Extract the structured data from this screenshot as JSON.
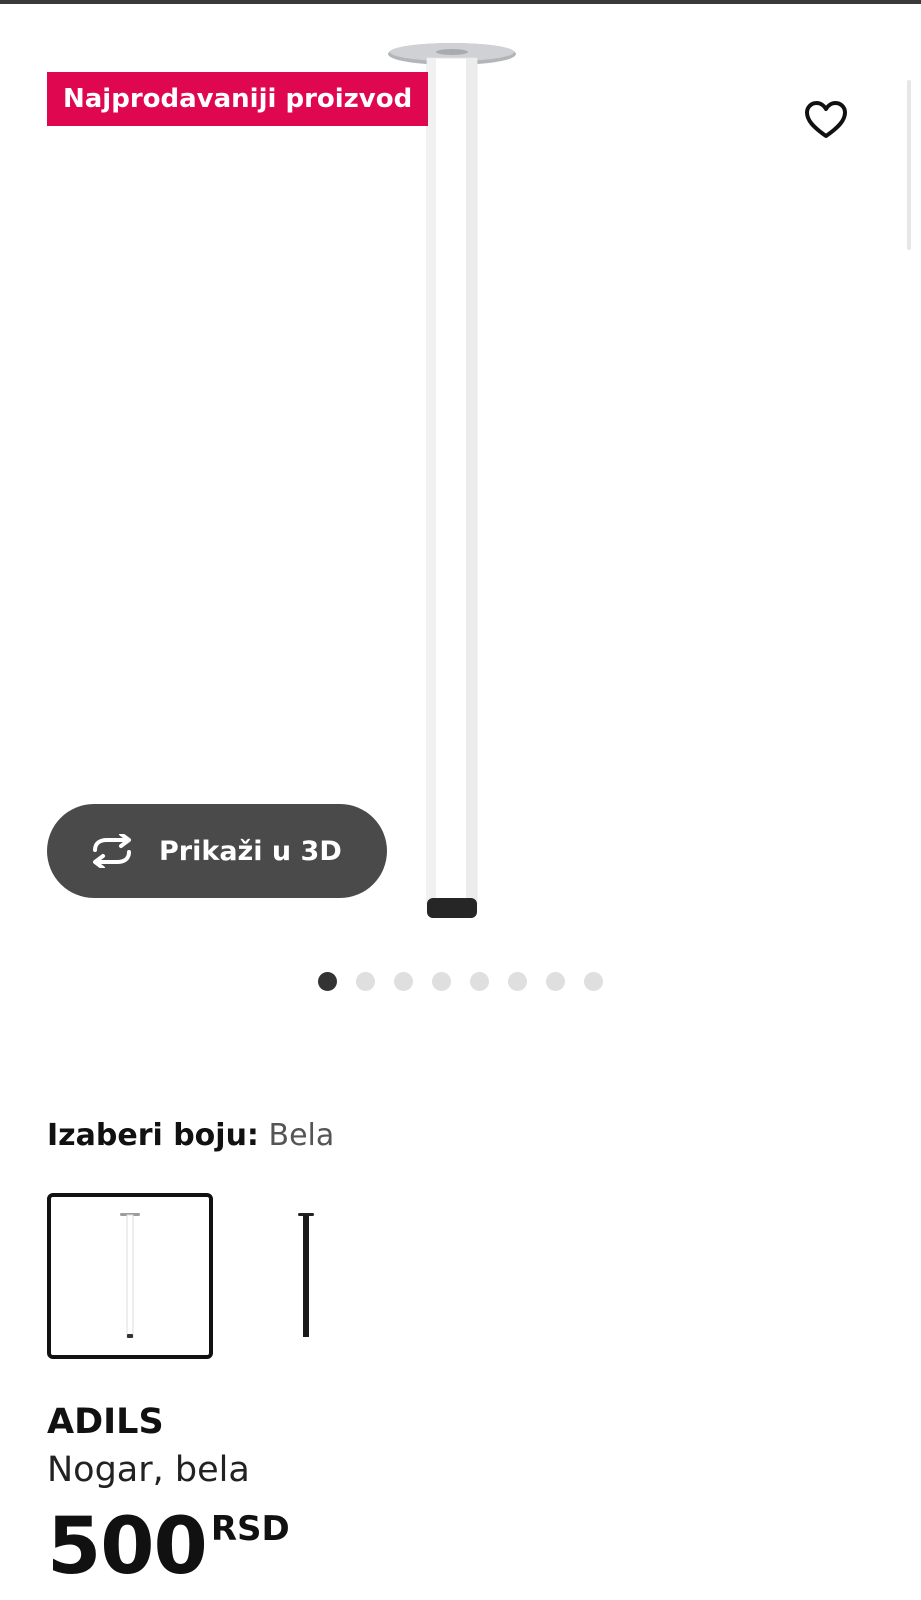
{
  "gallery": {
    "badge": "Najprodavaniji proizvod",
    "favorite_icon": "heart-outline-icon",
    "view_3d_icon": "rotate-arrows-icon",
    "view_3d_label": "Prikaži u 3D",
    "image_count": 8,
    "active_image": 1,
    "product_image_icon": "table-leg-white"
  },
  "colors": {
    "label": "Izaberi boju:",
    "selected_value": "Bela",
    "options": [
      {
        "name": "white-table-leg",
        "color": "#ffffff",
        "selected": true
      },
      {
        "name": "black-table-leg",
        "color": "#1a1a1a",
        "selected": false
      }
    ]
  },
  "product": {
    "name": "ADILS",
    "description": "Nogar, bela",
    "price": "500",
    "currency": "RSD"
  },
  "theme": {
    "badge_color": "#e00751",
    "button_color": "#4a4a4a",
    "dot_active": "#333333",
    "dot_inactive": "#dfdfdf"
  }
}
